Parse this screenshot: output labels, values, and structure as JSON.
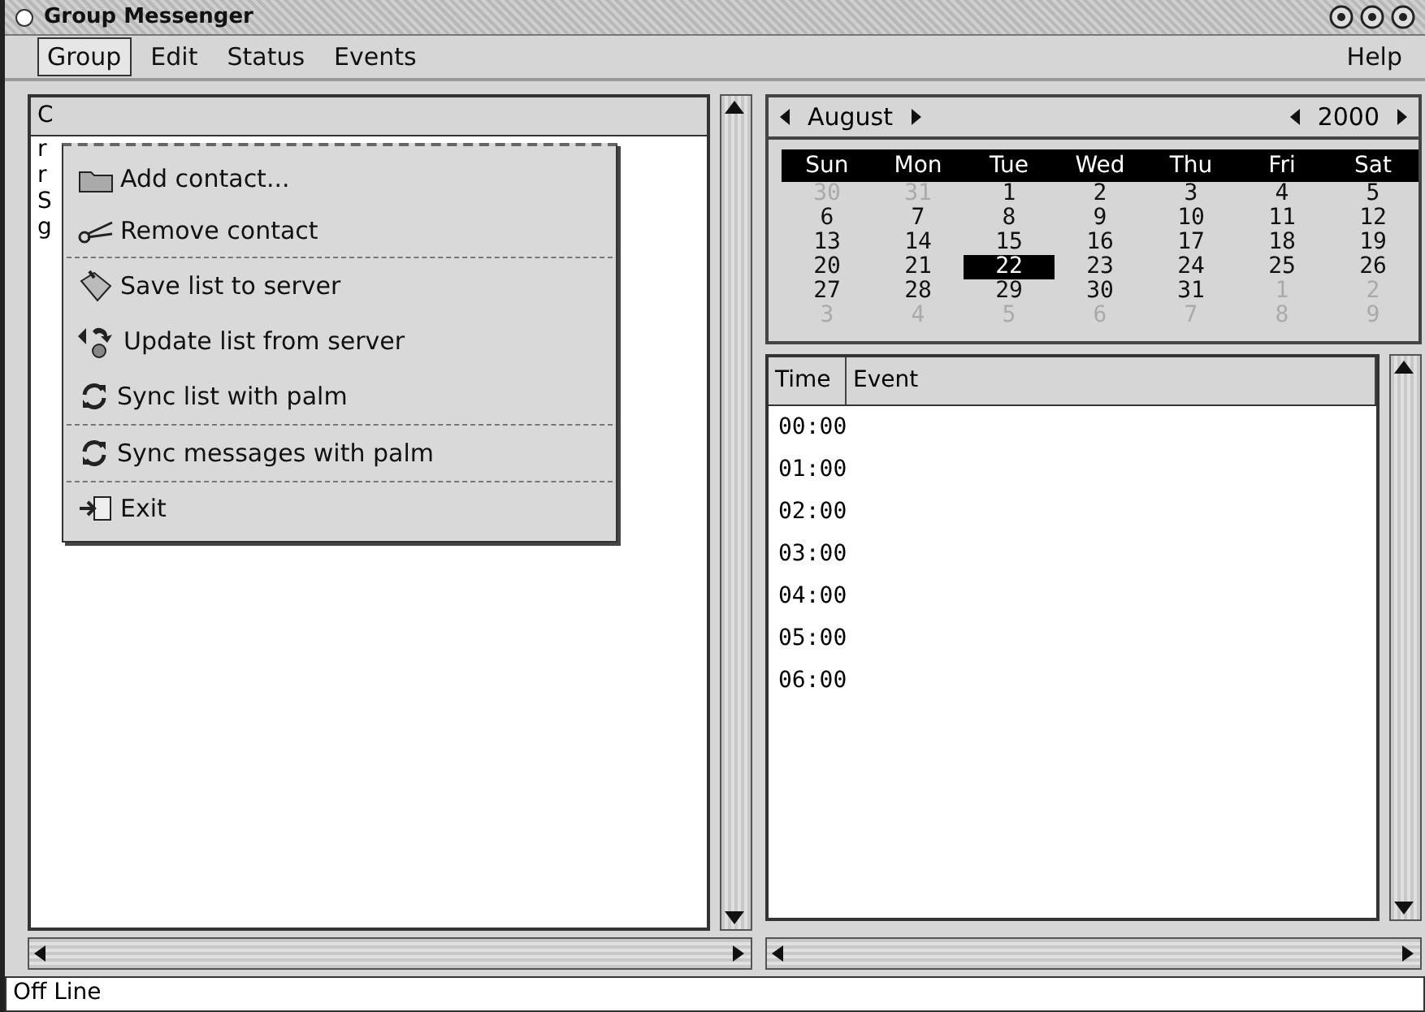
{
  "window": {
    "title": "Group Messenger"
  },
  "menubar": {
    "left": [
      {
        "label": "Group",
        "selected": true
      },
      {
        "label": "Edit",
        "selected": false
      },
      {
        "label": "Status",
        "selected": false
      },
      {
        "label": "Events",
        "selected": false
      }
    ],
    "right": [
      {
        "label": "Help",
        "selected": false
      }
    ]
  },
  "contacts": {
    "header": "C",
    "rows": [
      "r",
      "r",
      "S",
      "g"
    ]
  },
  "group_menu": [
    {
      "kind": "item",
      "label": "Add contact..."
    },
    {
      "kind": "item",
      "label": "Remove contact"
    },
    {
      "kind": "separator"
    },
    {
      "kind": "item",
      "label": "Save list to server"
    },
    {
      "kind": "item",
      "label": "Update list from server"
    },
    {
      "kind": "item",
      "label": "Sync list with palm"
    },
    {
      "kind": "separator"
    },
    {
      "kind": "item",
      "label": "Sync messages with palm"
    },
    {
      "kind": "separator"
    },
    {
      "kind": "item",
      "label": "Exit"
    }
  ],
  "calendar": {
    "month": "August",
    "year": "2000",
    "weekdays": [
      "Sun",
      "Mon",
      "Tue",
      "Wed",
      "Thu",
      "Fri",
      "Sat"
    ],
    "days": [
      {
        "label": "30",
        "kind": "other",
        "selected": false
      },
      {
        "label": "31",
        "kind": "other",
        "selected": false
      },
      {
        "label": "1",
        "kind": "month",
        "selected": false
      },
      {
        "label": "2",
        "kind": "month",
        "selected": false
      },
      {
        "label": "3",
        "kind": "month",
        "selected": false
      },
      {
        "label": "4",
        "kind": "month",
        "selected": false
      },
      {
        "label": "5",
        "kind": "month",
        "selected": false
      },
      {
        "label": "6",
        "kind": "month",
        "selected": false
      },
      {
        "label": "7",
        "kind": "month",
        "selected": false
      },
      {
        "label": "8",
        "kind": "month",
        "selected": false
      },
      {
        "label": "9",
        "kind": "month",
        "selected": false
      },
      {
        "label": "10",
        "kind": "month",
        "selected": false
      },
      {
        "label": "11",
        "kind": "month",
        "selected": false
      },
      {
        "label": "12",
        "kind": "month",
        "selected": false
      },
      {
        "label": "13",
        "kind": "month",
        "selected": false
      },
      {
        "label": "14",
        "kind": "month",
        "selected": false
      },
      {
        "label": "15",
        "kind": "month",
        "selected": false
      },
      {
        "label": "16",
        "kind": "month",
        "selected": false
      },
      {
        "label": "17",
        "kind": "month",
        "selected": false
      },
      {
        "label": "18",
        "kind": "month",
        "selected": false
      },
      {
        "label": "19",
        "kind": "month",
        "selected": false
      },
      {
        "label": "20",
        "kind": "month",
        "selected": false
      },
      {
        "label": "21",
        "kind": "month",
        "selected": false
      },
      {
        "label": "22",
        "kind": "month",
        "selected": true
      },
      {
        "label": "23",
        "kind": "month",
        "selected": false
      },
      {
        "label": "24",
        "kind": "month",
        "selected": false
      },
      {
        "label": "25",
        "kind": "month",
        "selected": false
      },
      {
        "label": "26",
        "kind": "month",
        "selected": false
      },
      {
        "label": "27",
        "kind": "month",
        "selected": false
      },
      {
        "label": "28",
        "kind": "month",
        "selected": false
      },
      {
        "label": "29",
        "kind": "month",
        "selected": false
      },
      {
        "label": "30",
        "kind": "month",
        "selected": false
      },
      {
        "label": "31",
        "kind": "month",
        "selected": false
      },
      {
        "label": "1",
        "kind": "other",
        "selected": false
      },
      {
        "label": "2",
        "kind": "other",
        "selected": false
      },
      {
        "label": "3",
        "kind": "other",
        "selected": false
      },
      {
        "label": "4",
        "kind": "other",
        "selected": false
      },
      {
        "label": "5",
        "kind": "other",
        "selected": false
      },
      {
        "label": "6",
        "kind": "other",
        "selected": false
      },
      {
        "label": "7",
        "kind": "other",
        "selected": false
      },
      {
        "label": "8",
        "kind": "other",
        "selected": false
      },
      {
        "label": "9",
        "kind": "other",
        "selected": false
      }
    ]
  },
  "events": {
    "columns": [
      "Time",
      "Event"
    ],
    "rows": [
      "00:00",
      "01:00",
      "02:00",
      "03:00",
      "04:00",
      "05:00",
      "06:00"
    ]
  },
  "status_bar": "Off Line"
}
